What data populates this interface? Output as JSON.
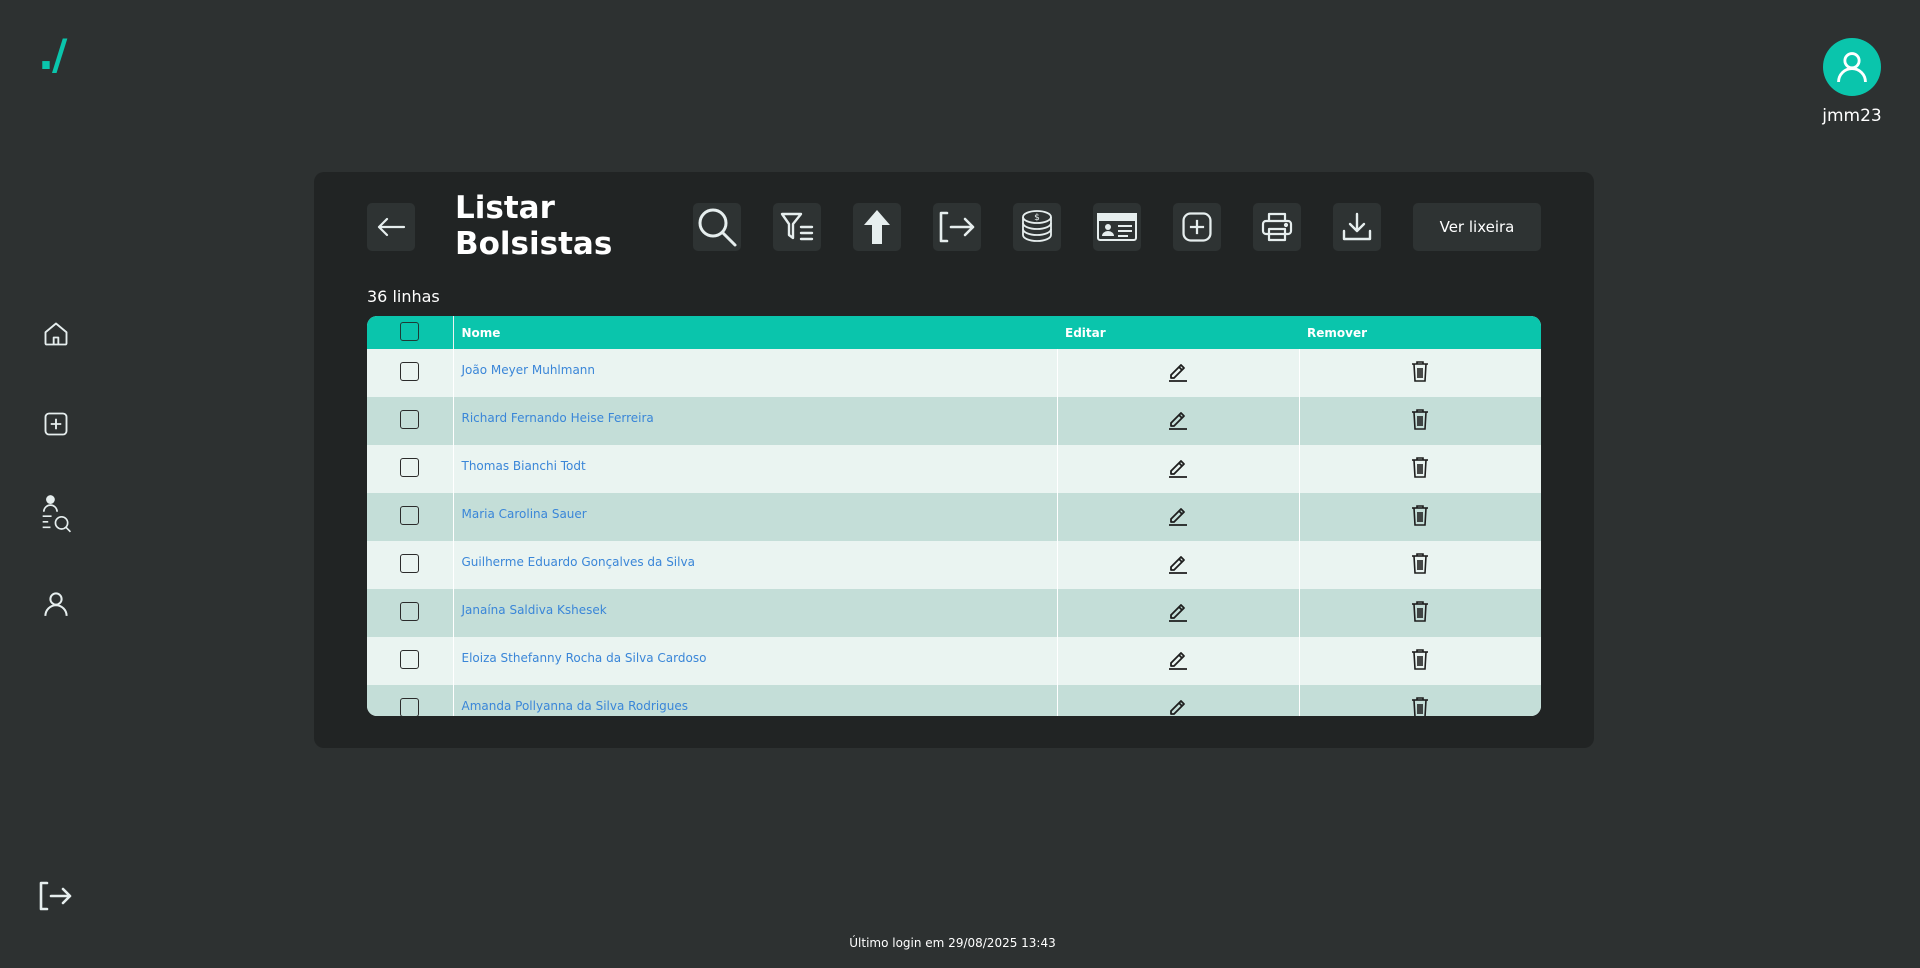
{
  "app": {
    "logo": "./"
  },
  "user": {
    "username": "jmm23"
  },
  "page": {
    "title": "Listar Bolsistas",
    "row_count": "36 linhas",
    "trash_button": "Ver lixeira"
  },
  "table": {
    "columns": [
      "Nome",
      "Editar",
      "Remover"
    ],
    "rows": [
      {
        "name": "João Meyer Muhlmann"
      },
      {
        "name": "Richard Fernando Heise Ferreira"
      },
      {
        "name": "Thomas Bianchi Todt"
      },
      {
        "name": "Maria Carolina Sauer"
      },
      {
        "name": "Guilherme Eduardo Gonçalves da Silva"
      },
      {
        "name": "Janaína Saldiva Kshesek"
      },
      {
        "name": "Eloiza Sthefanny Rocha da Silva Cardoso"
      },
      {
        "name": "Amanda Pollyanna da Silva Rodrigues"
      }
    ]
  },
  "footer": {
    "last_login": "Último login em 29/08/2025 13:43"
  },
  "colors": {
    "accent": "#0ac5ac",
    "background": "#2d3131",
    "panel": "#212424",
    "link": "#3a86d8"
  }
}
